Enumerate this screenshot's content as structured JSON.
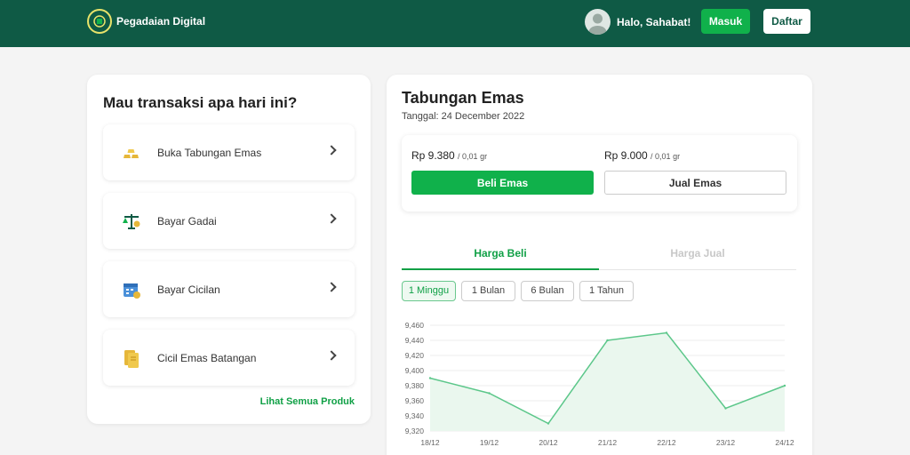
{
  "header": {
    "brand": "Pegadaian Digital",
    "greeting": "Halo, Sahabat!",
    "login": "Masuk",
    "register": "Daftar",
    "colors": {
      "bar": "#0f5a45",
      "accent": "#10b14b"
    }
  },
  "left": {
    "title": "Mau transaksi apa hari ini?",
    "items": [
      {
        "label": "Buka Tabungan Emas",
        "icon": "gold-bars-icon"
      },
      {
        "label": "Bayar Gadai",
        "icon": "scale-icon"
      },
      {
        "label": "Bayar Cicilan",
        "icon": "calendar-icon"
      },
      {
        "label": "Cicil Emas Batangan",
        "icon": "gold-card-icon"
      }
    ],
    "see_all": "Lihat Semua Produk"
  },
  "right": {
    "title": "Tabungan Emas",
    "date": "Tanggal: 24 December 2022",
    "buy_price": "Rp 9.380",
    "buy_unit": "/ 0,01 gr",
    "sell_price": "Rp 9.000",
    "sell_unit": "/ 0,01 gr",
    "buy_button": "Beli Emas",
    "sell_button": "Jual Emas",
    "tabs": [
      "Harga Beli",
      "Harga Jual"
    ],
    "ranges": [
      "1 Minggu",
      "1 Bulan",
      "6 Bulan",
      "1 Tahun"
    ]
  },
  "chart_data": {
    "type": "area",
    "categories": [
      "18/12",
      "19/12",
      "20/12",
      "21/12",
      "22/12",
      "23/12",
      "24/12"
    ],
    "values": [
      9390,
      9370,
      9330,
      9440,
      9450,
      9350,
      9380
    ],
    "yticks": [
      "9,460",
      "9,440",
      "9,420",
      "9,400",
      "9,380",
      "9,360",
      "9,340",
      "9,320"
    ],
    "ylim": [
      9320,
      9460
    ],
    "color": "#5cc78a"
  }
}
